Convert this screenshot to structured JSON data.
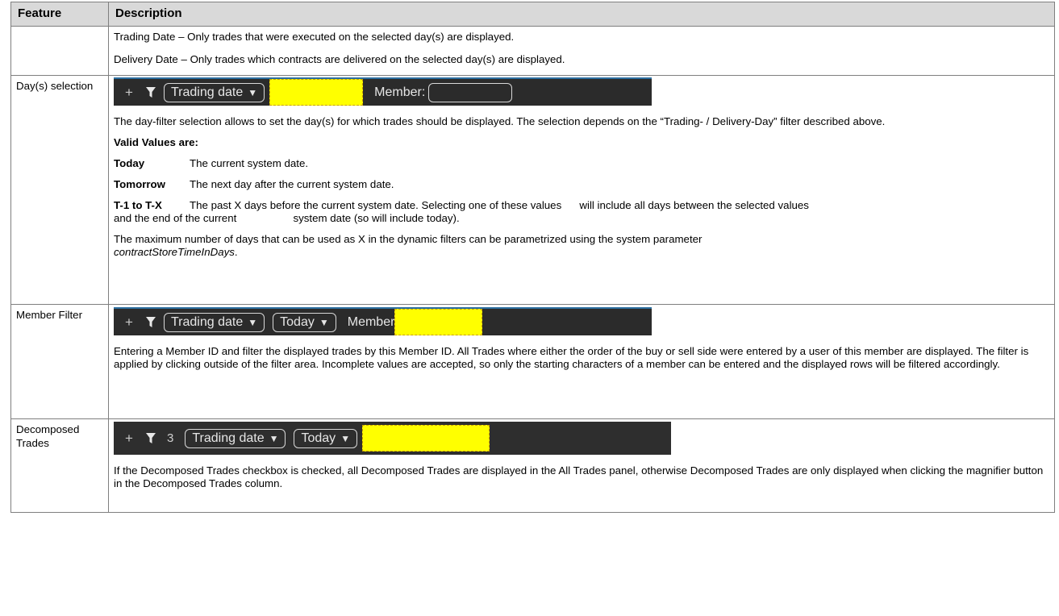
{
  "header": {
    "feature": "Feature",
    "description": "Description"
  },
  "row0": {
    "trading_date_text": "Trading Date – Only trades that were executed on the selected day(s) are displayed.",
    "delivery_date_text": "Delivery Date – Only trades which contracts are delivered on the selected day(s) are displayed."
  },
  "row_day": {
    "feature": "Day(s) selection",
    "toolbar": {
      "plus": "+",
      "trading_date": "Trading date",
      "member_label": "Member:"
    },
    "intro": "The day-filter selection allows to set the day(s) for which trades should be displayed. The selection depends on the “Trading- / Delivery-Day” filter described above.",
    "valid_values": "Valid Values are:",
    "values": [
      {
        "term": "Today",
        "def": "The current system date."
      },
      {
        "term": "Tomorrow",
        "def": "The next day after the current system date."
      }
    ],
    "tx_term": "T-1 to T-X",
    "tx_def_line1": "The past X days before the current system date. Selecting one of these values      will include all days between the selected values",
    "tx_def_line2": "and the end of the current                   system date (so will include today).",
    "max_text_line1": "The maximum number of days that can be used as X in the dynamic filters can be parametrized using the system parameter",
    "max_text_param": "contractStoreTimeInDays",
    "max_text_end": "."
  },
  "row_member": {
    "feature": "Member Filter",
    "toolbar": {
      "plus": "+",
      "trading_date": "Trading date",
      "today": "Today",
      "member_label": "Member"
    },
    "text": "Entering a Member ID and filter the displayed trades by this Member ID. All Trades where either the order of the buy or sell side were entered by a user of this member are displayed. The filter is applied by clicking outside of the filter area. Incomplete values are accepted, so only the starting characters of a member can be entered and the displayed rows will be filtered accordingly."
  },
  "row_decomposed": {
    "feature": "Decomposed Trades",
    "toolbar": {
      "plus": "+",
      "count": "3",
      "trading_date": "Trading date",
      "today": "Today"
    },
    "text": "If the Decomposed Trades checkbox is checked, all Decomposed Trades are displayed in the All Trades panel, otherwise Decomposed Trades are only displayed when clicking the magnifier button in the Decomposed Trades column."
  },
  "colors": {
    "toolbar_bg": "#2b2b2b",
    "highlight": "#ffff00",
    "header_bg": "#d9d9d9"
  }
}
